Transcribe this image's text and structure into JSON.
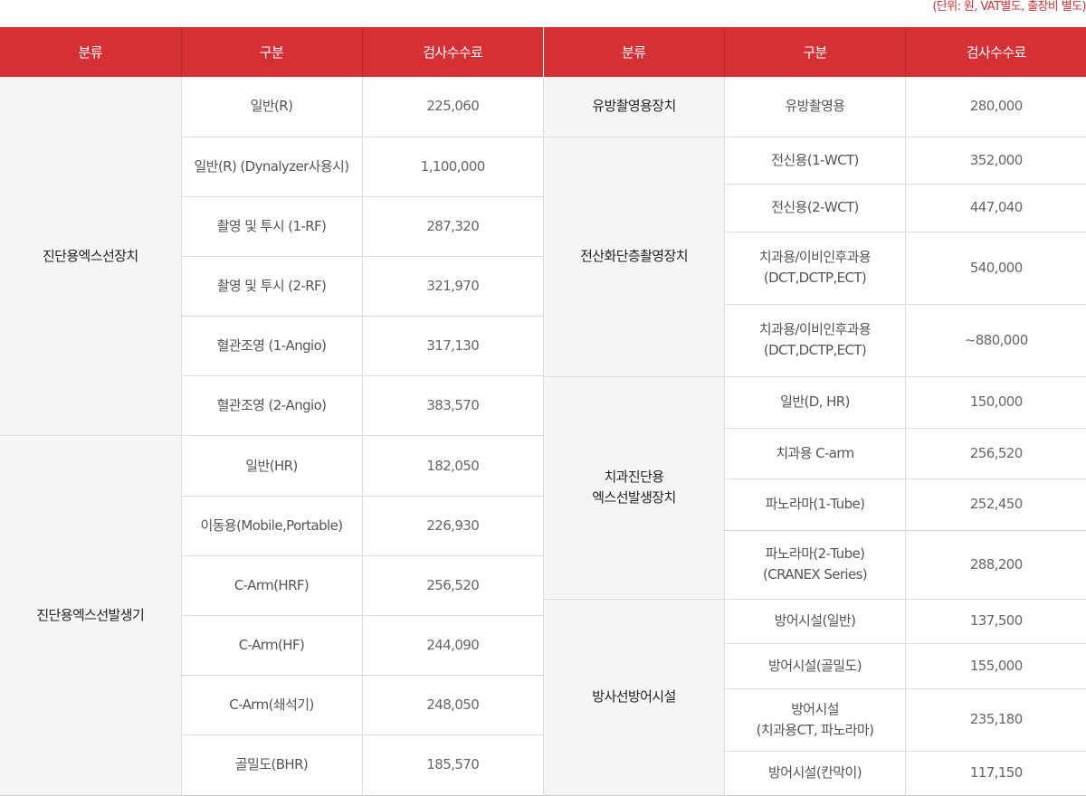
{
  "unit_note": "(단위: 원, VAT별도, 출장비 별도)",
  "headers": {
    "category": "분류",
    "type": "구분",
    "fee": "검사수수료"
  },
  "left_groups": [
    {
      "category": "진단용엑스선장치",
      "rows": [
        {
          "type": "일반(R)",
          "fee": "225,060"
        },
        {
          "type": "일반(R) (Dynalyzer사용시)",
          "fee": "1,100,000"
        },
        {
          "type": "촬영 및 투시 (1-RF)",
          "fee": "287,320"
        },
        {
          "type": "촬영 및 투시 (2-RF)",
          "fee": "321,970"
        },
        {
          "type": "혈관조영 (1-Angio)",
          "fee": "317,130"
        },
        {
          "type": "혈관조영 (2-Angio)",
          "fee": "383,570"
        }
      ]
    },
    {
      "category": "진단용엑스선발생기",
      "rows": [
        {
          "type": "일반(HR)",
          "fee": "182,050"
        },
        {
          "type": "이동용(Mobile,Portable)",
          "fee": "226,930"
        },
        {
          "type": "C-Arm(HRF)",
          "fee": "256,520"
        },
        {
          "type": "C-Arm(HF)",
          "fee": "244,090"
        },
        {
          "type": "C-Arm(쇄석기)",
          "fee": "248,050"
        },
        {
          "type": "골밀도(BHR)",
          "fee": "185,570"
        }
      ]
    }
  ],
  "right_groups": [
    {
      "category": [
        "유방촬영용장치"
      ],
      "rows": [
        {
          "type": [
            "유방촬영용"
          ],
          "fee": "280,000"
        }
      ]
    },
    {
      "category": [
        "전산화단층촬영장치"
      ],
      "rows": [
        {
          "type": [
            "전신용(1-WCT)"
          ],
          "fee": "352,000"
        },
        {
          "type": [
            "전신용(2-WCT)"
          ],
          "fee": "447,040"
        },
        {
          "type": [
            "치과용/이비인후과용",
            "(DCT,DCTP,ECT)"
          ],
          "fee": "540,000"
        },
        {
          "type": [
            "치과용/이비인후과용",
            "(DCT,DCTP,ECT)"
          ],
          "fee": "~880,000"
        }
      ]
    },
    {
      "category": [
        "치과진단용",
        "엑스선발생장치"
      ],
      "rows": [
        {
          "type": [
            "일반(D, HR)"
          ],
          "fee": "150,000"
        },
        {
          "type": [
            "치과용 C-arm"
          ],
          "fee": "256,520"
        },
        {
          "type": [
            "파노라마(1-Tube)"
          ],
          "fee": "252,450"
        },
        {
          "type": [
            "파노라마(2-Tube)",
            "(CRANEX Series)"
          ],
          "fee": "288,200"
        }
      ]
    },
    {
      "category": [
        "방사선방어시설"
      ],
      "rows": [
        {
          "type": [
            "방어시설(일반)"
          ],
          "fee": "137,500"
        },
        {
          "type": [
            "방어시설(골밀도)"
          ],
          "fee": "155,000"
        },
        {
          "type": [
            "방어시설",
            "(치과용CT, 파노라마)"
          ],
          "fee": "235,180"
        },
        {
          "type": [
            "방어시설(칸막이)"
          ],
          "fee": "117,150"
        }
      ]
    }
  ]
}
